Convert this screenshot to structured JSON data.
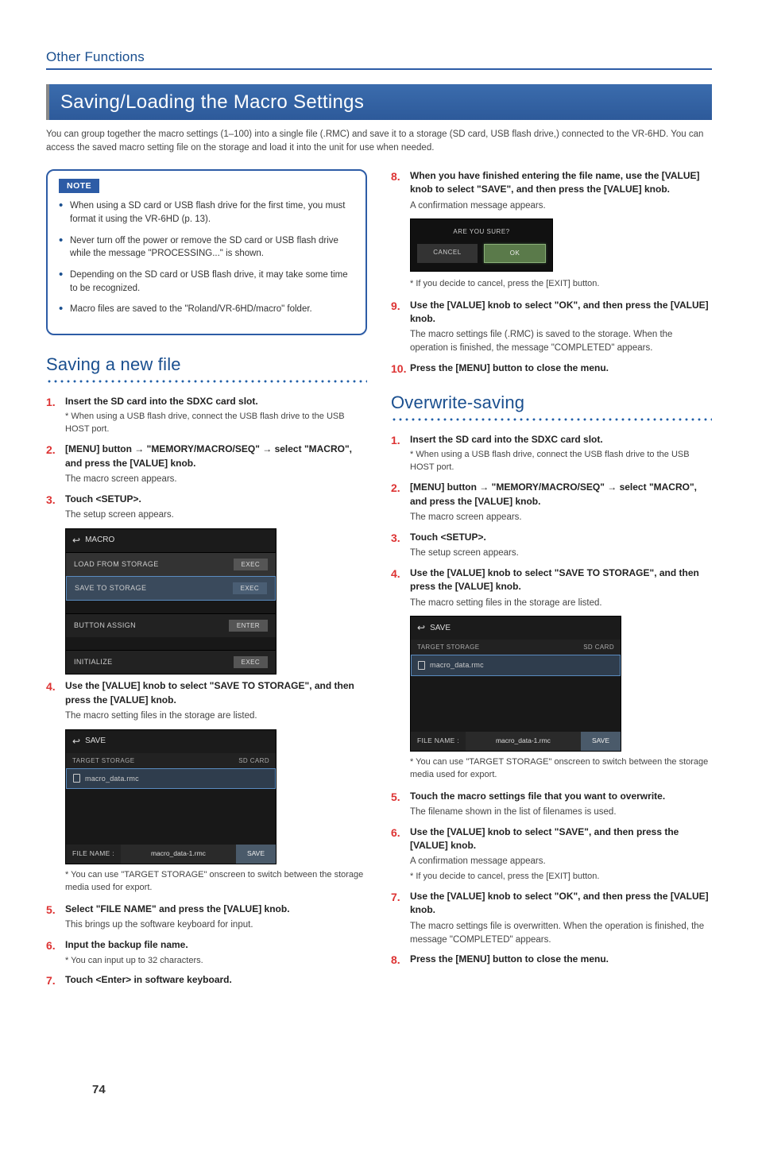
{
  "header": {
    "section": "Other Functions"
  },
  "title": "Saving/Loading the Macro Settings",
  "intro": "You can group together the macro settings (1–100) into a single file (.RMC) and save it to a storage (SD card, USB flash drive,) connected to the VR-6HD. You can access the saved macro setting file on the storage and load it into the unit for use when needed.",
  "note": {
    "label": "NOTE",
    "items": [
      "When using a SD card or USB flash drive for the first time, you must format it using the VR-6HD (p. 13).",
      "Never turn off the power or remove the SD card or USB flash drive while the message \"PROCESSING...\" is shown.",
      "Depending on the SD card or USB flash drive, it may take some time to be recognized.",
      "Macro files are saved to the \"Roland/VR-6HD/macro\" folder."
    ]
  },
  "left": {
    "heading": "Saving a new file",
    "steps": [
      {
        "n": "1.",
        "main": "Insert the SD card into the SDXC card slot.",
        "note": "When using a USB flash drive, connect the USB flash drive to the USB HOST port."
      },
      {
        "n": "2.",
        "main": "[MENU] button → \"MEMORY/MACRO/SEQ\" → select \"MACRO\", and press the [VALUE] knob.",
        "sub": "The macro screen appears."
      },
      {
        "n": "3.",
        "main": "Touch <SETUP>.",
        "sub": "The setup screen appears."
      },
      {
        "n": "4.",
        "main": "Use the [VALUE] knob to select \"SAVE TO STORAGE\", and then press the [VALUE] knob.",
        "sub": "The macro setting files in the storage are listed."
      },
      {
        "n": "5.",
        "main": "Select \"FILE NAME\" and press the [VALUE] knob.",
        "sub": "This brings up the software keyboard for input."
      },
      {
        "n": "6.",
        "main": "Input the backup file name.",
        "note": "You can input up to 32 characters."
      },
      {
        "n": "7.",
        "main": "Touch <Enter> in software keyboard."
      }
    ],
    "ss_macro": {
      "title": "MACRO",
      "rows": [
        {
          "label": "LOAD FROM STORAGE",
          "action": "EXEC",
          "hl": false
        },
        {
          "label": "SAVE TO STORAGE",
          "action": "EXEC",
          "hl": true
        },
        {
          "label": "BUTTON ASSIGN",
          "action": "ENTER",
          "hl": false,
          "dk": true
        },
        {
          "label": "INITIALIZE",
          "action": "EXEC",
          "hl": false,
          "dk": true
        }
      ]
    },
    "ss_save": {
      "title": "SAVE",
      "target_label": "TARGET STORAGE",
      "target_value": "SD CARD",
      "file": "macro_data.rmc",
      "footer_label": "FILE NAME :",
      "footer_value": "macro_data-1.rmc",
      "footer_btn": "SAVE"
    },
    "ss_save_note": "You can use \"TARGET STORAGE\" onscreen to switch between the storage media used for export."
  },
  "right": {
    "steps_top": [
      {
        "n": "8.",
        "main": "When you have finished entering the file name, use the [VALUE] knob to select \"SAVE\", and then press the [VALUE] knob.",
        "sub": "A confirmation message appears."
      },
      {
        "n": "9.",
        "main": "Use the [VALUE] knob to select \"OK\", and then press the [VALUE] knob.",
        "sub": "The macro settings file (.RMC) is saved to the storage. When the operation is finished, the message \"COMPLETED\" appears."
      },
      {
        "n": "10.",
        "main": "Press the [MENU] button to close the menu."
      }
    ],
    "confirm": {
      "title": "ARE YOU SURE?",
      "cancel": "CANCEL",
      "ok": "OK",
      "cancel_note": "If you decide to cancel, press the [EXIT] button."
    },
    "heading": "Overwrite-saving",
    "steps": [
      {
        "n": "1.",
        "main": "Insert the SD card into the SDXC card slot.",
        "note": "When using a USB flash drive, connect the USB flash drive to the USB HOST port."
      },
      {
        "n": "2.",
        "main": "[MENU] button → \"MEMORY/MACRO/SEQ\" → select \"MACRO\", and press the [VALUE] knob.",
        "sub": "The macro screen appears."
      },
      {
        "n": "3.",
        "main": "Touch <SETUP>.",
        "sub": "The setup screen appears."
      },
      {
        "n": "4.",
        "main": "Use the [VALUE] knob to select \"SAVE TO STORAGE\", and then press the [VALUE] knob.",
        "sub": "The macro setting files in the storage are listed."
      },
      {
        "n": "5.",
        "main": "Touch the macro settings file that you want to overwrite.",
        "sub": "The filename shown in the list of filenames is used."
      },
      {
        "n": "6.",
        "main": "Use the [VALUE] knob to select \"SAVE\", and then press the [VALUE] knob.",
        "sub": "A confirmation message appears.",
        "note": "If you decide to cancel, press the [EXIT] button."
      },
      {
        "n": "7.",
        "main": "Use the [VALUE] knob to select \"OK\", and then press the [VALUE] knob.",
        "sub": "The macro settings file is overwritten. When the operation is finished, the message \"COMPLETED\" appears."
      },
      {
        "n": "8.",
        "main": "Press the [MENU] button to close the menu."
      }
    ],
    "ss_save": {
      "title": "SAVE",
      "target_label": "TARGET STORAGE",
      "target_value": "SD CARD",
      "file": "macro_data.rmc",
      "footer_label": "FILE NAME :",
      "footer_value": "macro_data-1.rmc",
      "footer_btn": "SAVE"
    },
    "ss_save_note": "You can use \"TARGET STORAGE\" onscreen to switch between the storage media used for export."
  },
  "page_number": "74"
}
